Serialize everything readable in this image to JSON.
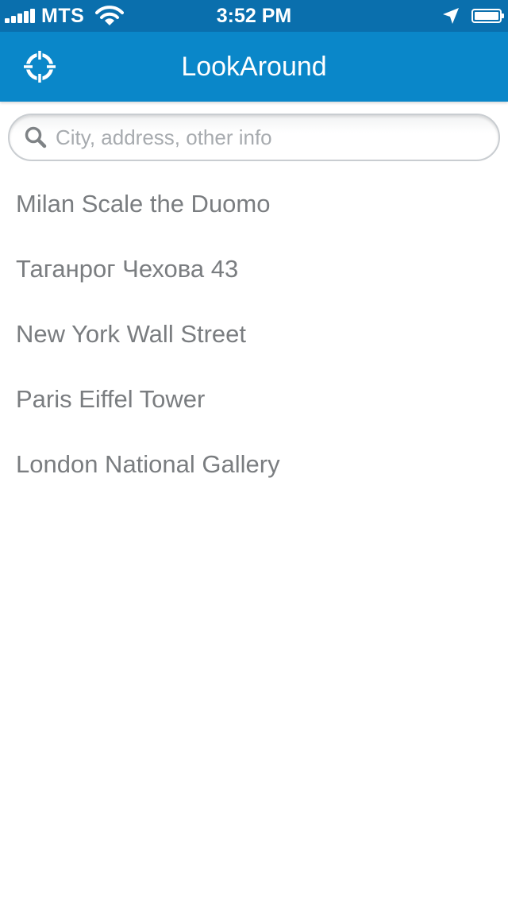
{
  "status_bar": {
    "carrier": "MTS",
    "time": "3:52 PM",
    "signal_icon": "signal-bars-icon",
    "wifi_icon": "wifi-icon",
    "location_icon": "location-arrow-icon",
    "battery_icon": "battery-icon",
    "battery_level": 1.0
  },
  "nav_bar": {
    "title": "LookAround",
    "left_icon": "crosshair-locate-icon",
    "background_color": "#0a87c9"
  },
  "search": {
    "value": "",
    "placeholder": "City, address, other info",
    "icon": "search-icon"
  },
  "places": [
    {
      "label": "Milan Scale the Duomo"
    },
    {
      "label": "Таганрог Чехова 43"
    },
    {
      "label": "New York Wall Street"
    },
    {
      "label": "Paris Eiffel Tower"
    },
    {
      "label": "London National Gallery"
    }
  ]
}
